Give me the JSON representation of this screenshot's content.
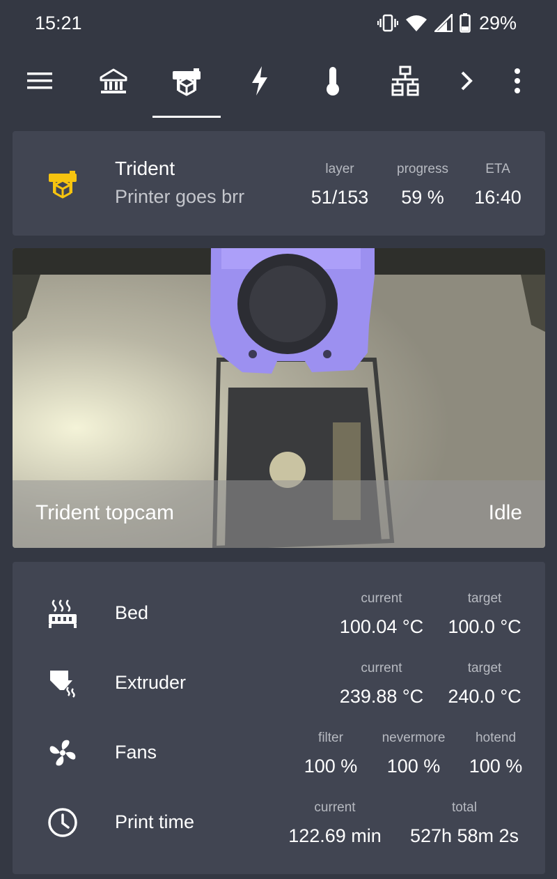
{
  "status_bar": {
    "time": "15:21",
    "battery_percent": "29%",
    "icons": [
      "vibrate-icon",
      "wifi-icon",
      "signal-icon",
      "battery-icon"
    ]
  },
  "nav": {
    "items": [
      {
        "name": "menu-icon"
      },
      {
        "name": "home-icon"
      },
      {
        "name": "printer-icon",
        "active": true
      },
      {
        "name": "lightning-icon"
      },
      {
        "name": "thermometer-icon"
      },
      {
        "name": "network-icon"
      },
      {
        "name": "chevron-right-icon"
      },
      {
        "name": "more-vert-icon"
      }
    ]
  },
  "job": {
    "title": "Trident",
    "subtitle": "Printer goes brr",
    "accent": "#f7c40f",
    "layer_label": "layer",
    "layer_value": "51/153",
    "progress_label": "progress",
    "progress_value": "59 %",
    "eta_label": "ETA",
    "eta_value": "16:40"
  },
  "camera": {
    "name": "Trident topcam",
    "status": "Idle"
  },
  "readings": {
    "bed": {
      "label": "Bed",
      "current_label": "current",
      "current_value": "100.04 °C",
      "target_label": "target",
      "target_value": "100.0 °C"
    },
    "extruder": {
      "label": "Extruder",
      "current_label": "current",
      "current_value": "239.88 °C",
      "target_label": "target",
      "target_value": "240.0 °C"
    },
    "fans": {
      "label": "Fans",
      "filter_label": "filter",
      "filter_value": "100 %",
      "nevermore_label": "nevermore",
      "nevermore_value": "100 %",
      "hotend_label": "hotend",
      "hotend_value": "100 %"
    },
    "print_time": {
      "label": "Print time",
      "current_label": "current",
      "current_value": "122.69 min",
      "total_label": "total",
      "total_value": "527h 58m 2s"
    }
  }
}
